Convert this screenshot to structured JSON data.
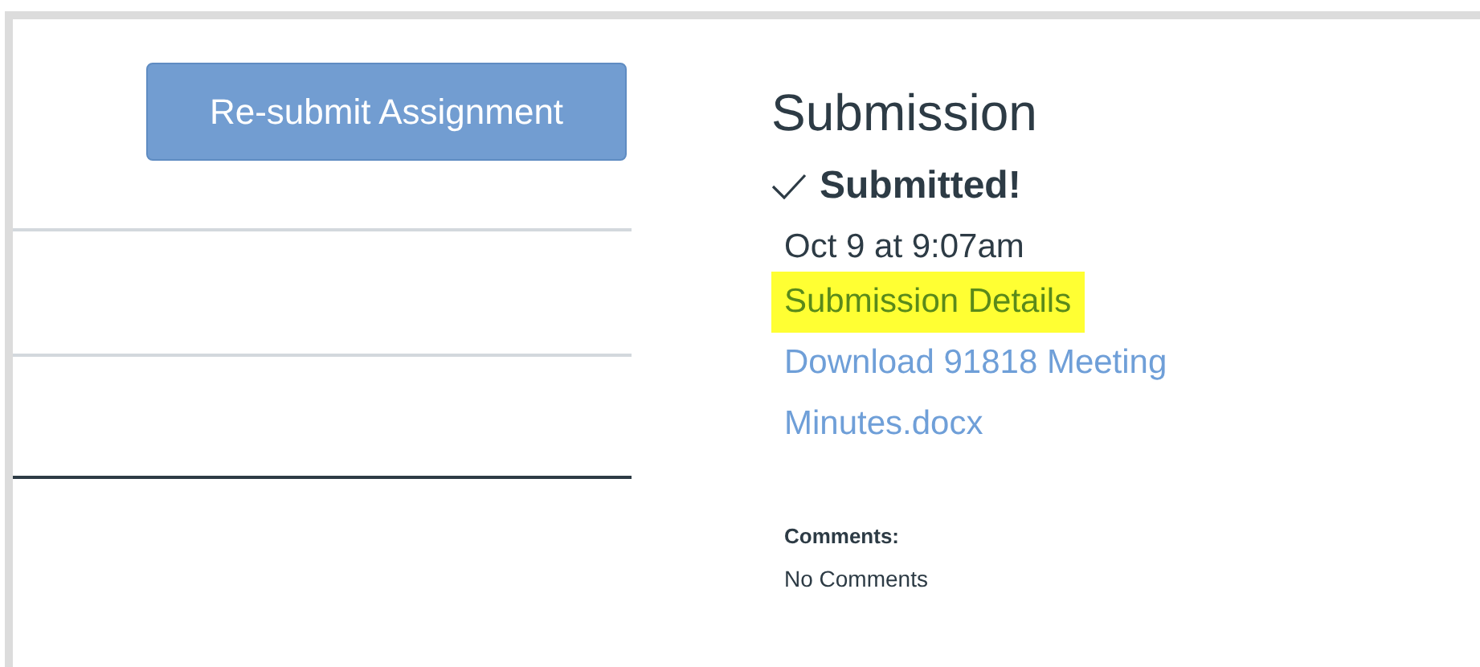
{
  "resubmit_button": "Re-submit Assignment",
  "submission": {
    "title": "Submission",
    "status": "Submitted!",
    "submitted": true,
    "date": "Oct 9 at 9:07am",
    "links": [
      {
        "label": "Submission Details",
        "highlighted": true
      },
      {
        "label": "Download 91818 Meeting Minutes.docx",
        "highlighted": false
      }
    ],
    "comments_label": "Comments:",
    "comments": "No Comments"
  }
}
